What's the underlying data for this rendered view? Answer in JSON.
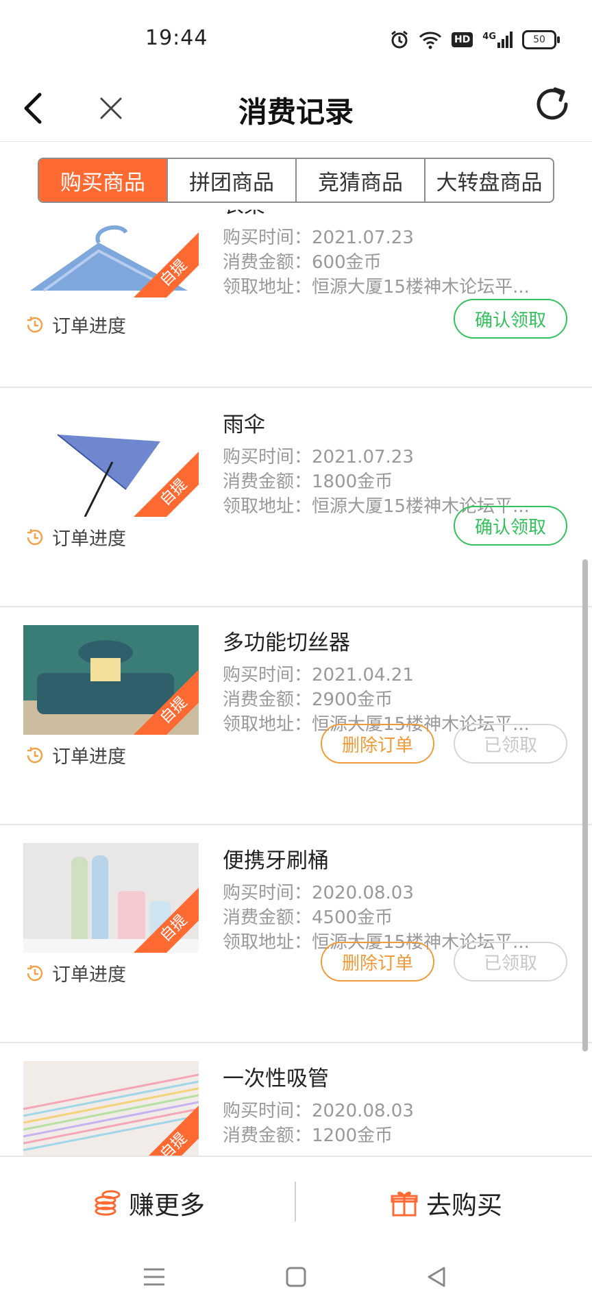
{
  "status_bar": {
    "time": "19:44",
    "network": "4G",
    "hd": "HD",
    "battery": "50"
  },
  "nav": {
    "title": "消费记录"
  },
  "tabs": [
    "购买商品",
    "拼团商品",
    "竞猜商品",
    "大转盘商品"
  ],
  "labels": {
    "buy_time": "购买时间：",
    "amount": "消费金额：",
    "address": "领取地址：",
    "tag": "自提",
    "progress": "订单进度"
  },
  "orders": [
    {
      "name": "衣架",
      "time": "2021.07.23",
      "amount": "600金币",
      "address": "恒源大厦15楼神木论坛平...",
      "buttons": [
        "确认领取"
      ]
    },
    {
      "name": "雨伞",
      "time": "2021.07.23",
      "amount": "1800金币",
      "address": "恒源大厦15楼神木论坛平...",
      "buttons": [
        "确认领取"
      ]
    },
    {
      "name": "多功能切丝器",
      "time": "2021.04.21",
      "amount": "2900金币",
      "address": "恒源大厦15楼神木论坛平...",
      "buttons": [
        "删除订单",
        "已领取"
      ]
    },
    {
      "name": "便携牙刷桶",
      "time": "2020.08.03",
      "amount": "4500金币",
      "address": "恒源大厦15楼神木论坛平...",
      "buttons": [
        "删除订单",
        "已领取"
      ]
    },
    {
      "name": "一次性吸管",
      "time": "2020.08.03",
      "amount": "1200金币",
      "address": "",
      "buttons": []
    }
  ],
  "bottom_bar": {
    "earn_label": "赚更多",
    "buy_label": "去购买"
  },
  "colors": {
    "accent": "#ff6a33",
    "green": "#34c15c",
    "orange_btn": "#f29a3a"
  }
}
